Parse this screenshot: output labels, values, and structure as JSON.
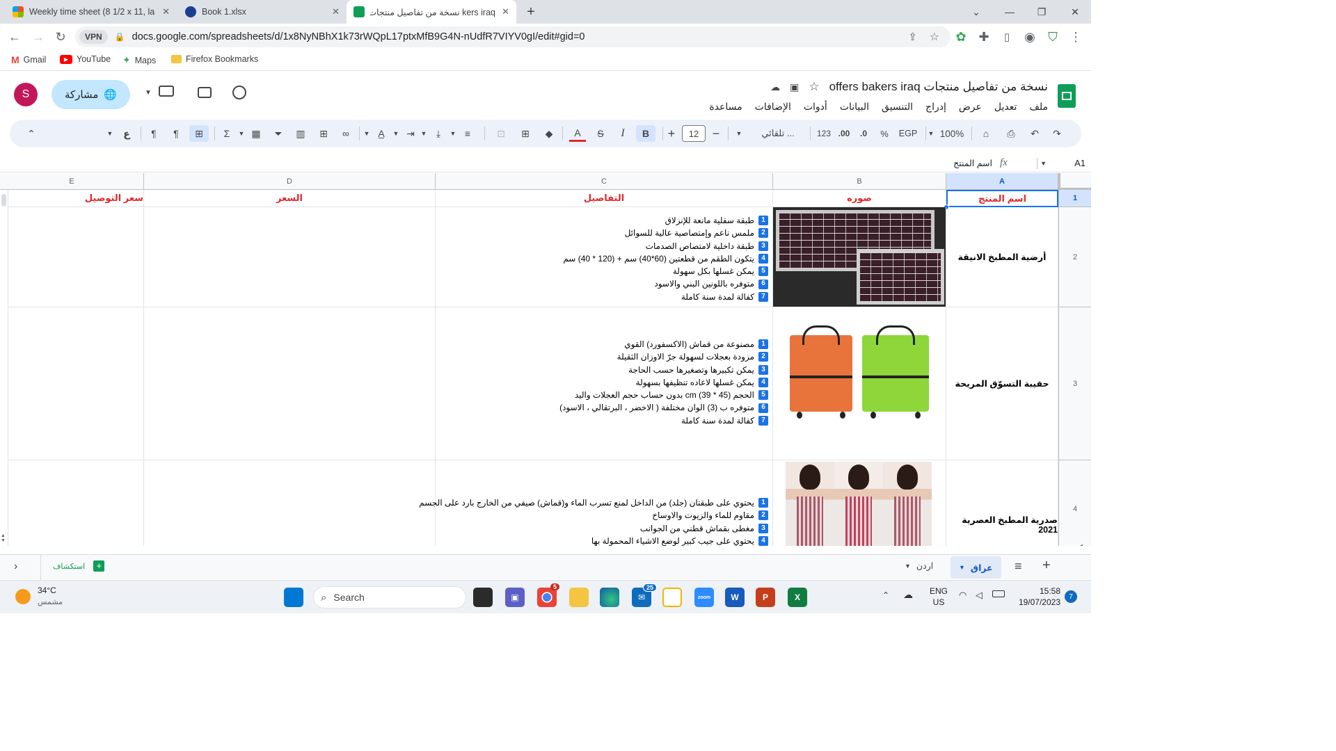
{
  "browser": {
    "tabs": [
      {
        "title": "Weekly time sheet (8 1/2 x 11, lar",
        "active": false,
        "icon": "microsoft-icon"
      },
      {
        "title": "Book 1.xlsx",
        "active": false,
        "icon": "globe-icon"
      },
      {
        "title": "kers iraq نسخة من تفاصيل منتجات",
        "active": true,
        "icon": "sheets-icon"
      }
    ],
    "url": "docs.google.com/spreadsheets/d/1x8NyNBhX1k73rWQpL17ptxMfB9G4N-nUdfR7VIYV0gI/edit#gid=0",
    "vpn_label": "VPN",
    "bookmarks": [
      "Gmail",
      "YouTube",
      "Maps",
      "Firefox Bookmarks"
    ]
  },
  "sheets": {
    "doc_title": "نسخة من تفاصيل منتجات offers bakers iraq",
    "menus": [
      "ملف",
      "تعديل",
      "عرض",
      "إدراج",
      "التنسيق",
      "البيانات",
      "أدوات",
      "الإضافات",
      "مساعدة"
    ],
    "share_label": "مشاركة",
    "avatar_letter": "S",
    "toolbar": {
      "zoom": "100%",
      "currency": "EGP",
      "percent": "%",
      "decimal_less": ".0",
      "decimal_more": ".00",
      "number_format": "123",
      "font_name": "تلقائي ...",
      "font_size": "12",
      "bold": "B",
      "italic": "I",
      "strike": "S",
      "text_color": "A",
      "sigma": "Σ",
      "rtl_glyph": "ع"
    },
    "cell_ref": "A1",
    "fx": "fx",
    "formula_value": "اسم المنتج",
    "columns": [
      "A",
      "B",
      "C",
      "D",
      "E"
    ],
    "header_row": {
      "A": "اسم المنتج",
      "B": "صوره",
      "C": "التفاصيل",
      "D": "السعر",
      "E": "سعر التوصيل"
    },
    "rows": [
      {
        "num": "2",
        "name": "أرضية المطبخ الانيقة",
        "details": [
          "طبقة سفلية مانعة للإنزلاق",
          "ملمس ناعم وإمتصاصية عالية للسوائل",
          "طبقة داخلية لامتصاص الصدمات",
          "يتكون الطقم من قطعتين (60*40) سم + (120 * 40) سم",
          "يمكن غسلها بكل سهولة",
          "متوفره باللونين البني والاسود",
          "كفالة لمدة سنة كاملة"
        ]
      },
      {
        "num": "3",
        "name": "حقيبة التسوّق المريحة",
        "details": [
          "مصنوعة من قماش (الاكسفورد) القوي",
          "مزودة بعجلات لسهولة جرّ الاوزان الثقيلة",
          "يمكن تكبيرها وتصغيرها حسب الحاجة",
          "يمكن غسلها لاعاده تنظيفها بسهولة",
          "الحجم (45 * 39) cm بدون حساب حجم العجلات واليد",
          "متوفره ب (3) الوان مختلفة ( الاخضر ، البرتقالي ، الاسود)",
          "كفالة لمدة سنة كاملة"
        ]
      },
      {
        "num": "4",
        "name": "صدرية المطبخ العصرية 2021",
        "details": [
          "يحتوي على طبقتان (جلد) من الداخل لمنع تسرب الماء و(قماش) صيفي من الخارج بارد على الجسم",
          "مقاوم للماء والزيوت والاوساخ",
          "مغطى بقماش قطني من الجوانب",
          "يحتوي على جيب كبير لوضع الاشياء المحمولة بها"
        ]
      }
    ],
    "sheet_tabs": [
      "عراق",
      "اردن"
    ],
    "explore_label": "استكشاف"
  },
  "taskbar": {
    "weather_temp": "34°C",
    "weather_desc": "مشمس",
    "search_placeholder": "Search",
    "lang": "ENG",
    "region": "US",
    "time": "15:58",
    "date": "19/07/2023",
    "notification_count": "7",
    "mail_badge": "25",
    "chrome_badge": "5"
  },
  "colors": {
    "header_red": "#e0292b",
    "sheets_green": "#0f9d58",
    "share_bg": "#c2e7ff",
    "toolbar_bg": "#edf2fa",
    "number_badge": "#1a73e8"
  }
}
